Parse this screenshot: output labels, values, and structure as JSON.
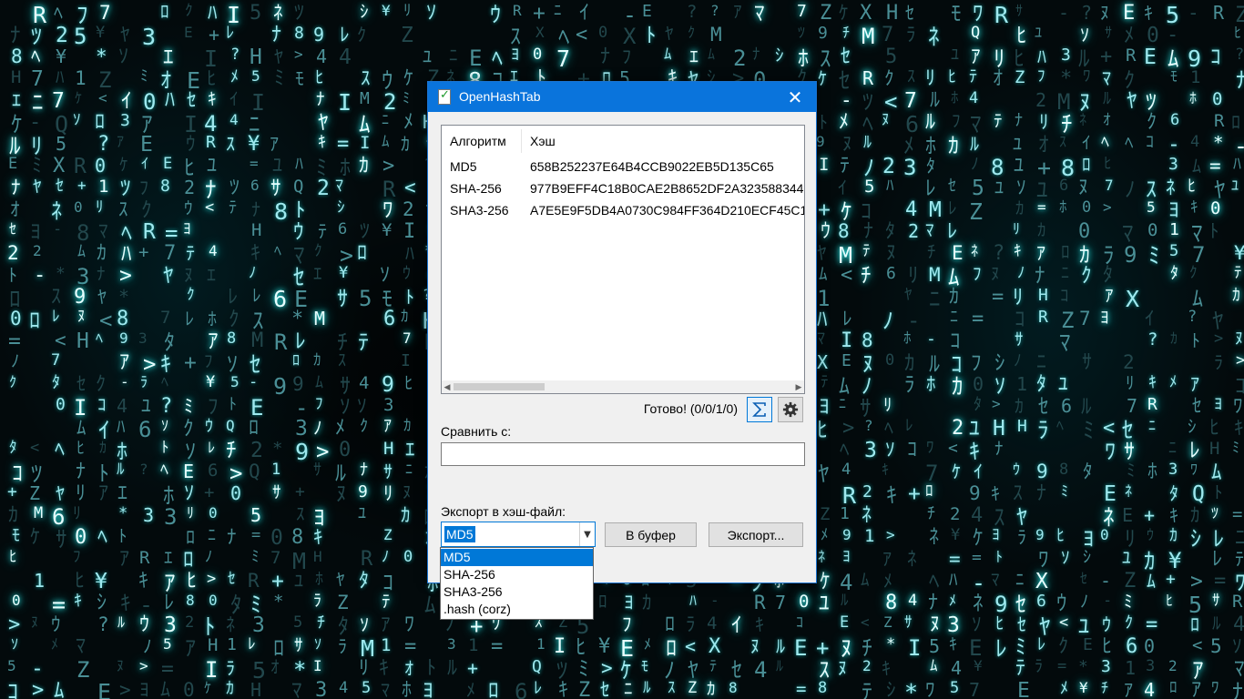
{
  "window": {
    "title": "OpenHashTab",
    "accent_color": "#0a74dc"
  },
  "hash_list": {
    "columns": [
      "Алгоритм",
      "Хэш"
    ],
    "rows": [
      {
        "algorithm": "MD5",
        "hash": "658B252237E64B4CCB9022EB5D135C65"
      },
      {
        "algorithm": "SHA-256",
        "hash": "977B9EFF4C18B0CAE2B8652DF2A323588344"
      },
      {
        "algorithm": "SHA3-256",
        "hash": "A7E5E9F5DB4A0730C984FF364D210ECF45C1E"
      }
    ]
  },
  "status": {
    "text": "Готово! (0/0/1/0)",
    "sum_icon": "sigma-icon",
    "settings_icon": "gear-icon"
  },
  "compare": {
    "label": "Сравнить с:",
    "value": ""
  },
  "export": {
    "label": "Экспорт в хэш-файл:",
    "selected": "MD5",
    "copy_button": "В буфер",
    "export_button": "Экспорт...",
    "options": [
      "MD5",
      "SHA-256",
      "SHA3-256",
      ".hash (corz)"
    ]
  }
}
